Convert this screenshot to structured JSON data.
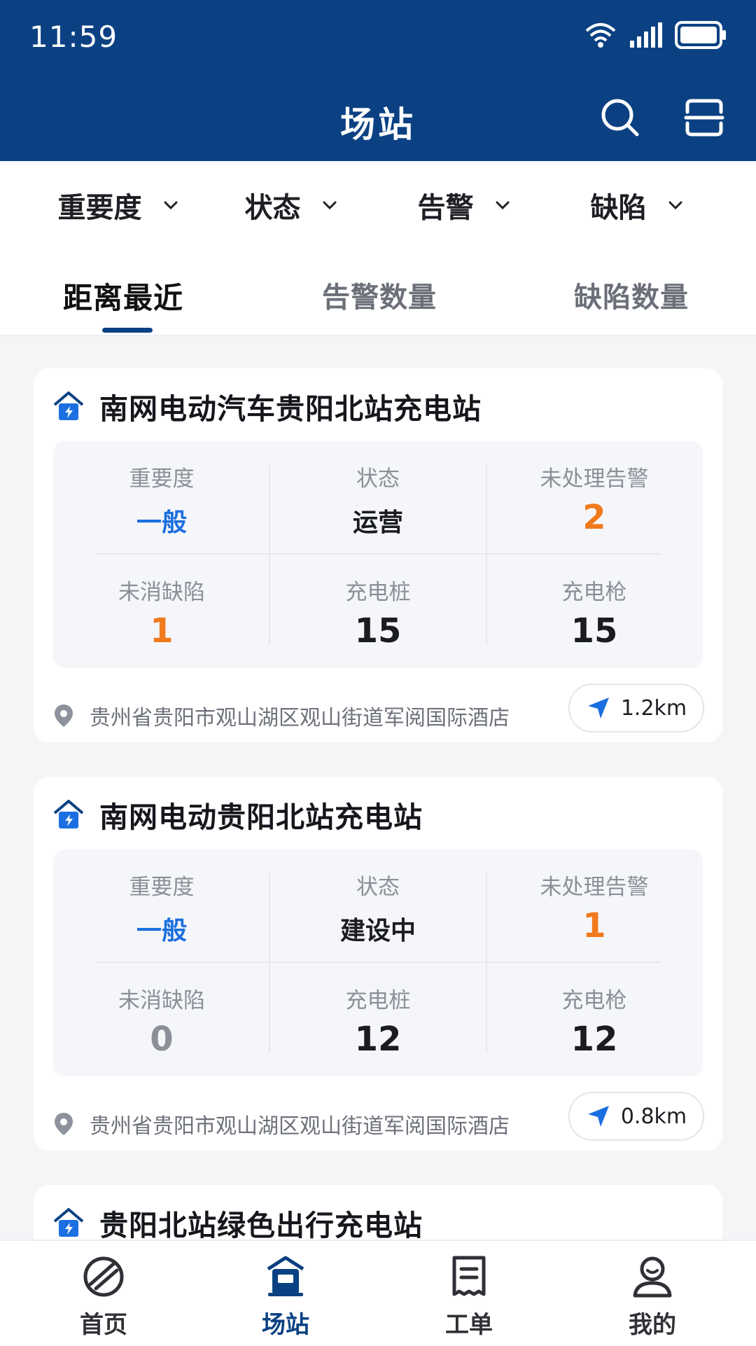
{
  "status_bar": {
    "time": "11:59"
  },
  "header": {
    "title": "场站"
  },
  "filters": [
    {
      "label": "重要度"
    },
    {
      "label": "状态"
    },
    {
      "label": "告警"
    },
    {
      "label": "缺陷"
    }
  ],
  "sort_tabs": [
    {
      "label": "距离最近",
      "active": true
    },
    {
      "label": "告警数量",
      "active": false
    },
    {
      "label": "缺陷数量",
      "active": false
    }
  ],
  "stations": [
    {
      "name": "南网电动汽车贵阳北站充电站",
      "stats": {
        "importance_label": "重要度",
        "importance_value": "一般",
        "status_label": "状态",
        "status_value": "运营",
        "alarms_label": "未处理告警",
        "alarms_value": "2",
        "defects_label": "未消缺陷",
        "defects_value": "1",
        "piles_label": "充电桩",
        "piles_value": "15",
        "guns_label": "充电枪",
        "guns_value": "15"
      },
      "address": "贵州省贵阳市观山湖区观山街道军阅国际酒店",
      "distance": "1.2km"
    },
    {
      "name": "南网电动贵阳北站充电站",
      "stats": {
        "importance_label": "重要度",
        "importance_value": "一般",
        "status_label": "状态",
        "status_value": "建设中",
        "alarms_label": "未处理告警",
        "alarms_value": "1",
        "defects_label": "未消缺陷",
        "defects_value": "0",
        "piles_label": "充电桩",
        "piles_value": "12",
        "guns_label": "充电枪",
        "guns_value": "12"
      },
      "address": "贵州省贵阳市观山湖区观山街道军阅国际酒店",
      "distance": "0.8km"
    },
    {
      "name": "贵阳北站绿色出行充电站"
    }
  ],
  "bottom_nav": [
    {
      "label": "首页",
      "icon": "home-globe-icon"
    },
    {
      "label": "场站",
      "icon": "station-icon",
      "active": true
    },
    {
      "label": "工单",
      "icon": "work-order-icon"
    },
    {
      "label": "我的",
      "icon": "profile-icon"
    }
  ],
  "colors": {
    "primary": "#0b4182",
    "accent_blue": "#1b6fe0",
    "accent_orange": "#f07a1c",
    "muted": "#8b8f98"
  }
}
